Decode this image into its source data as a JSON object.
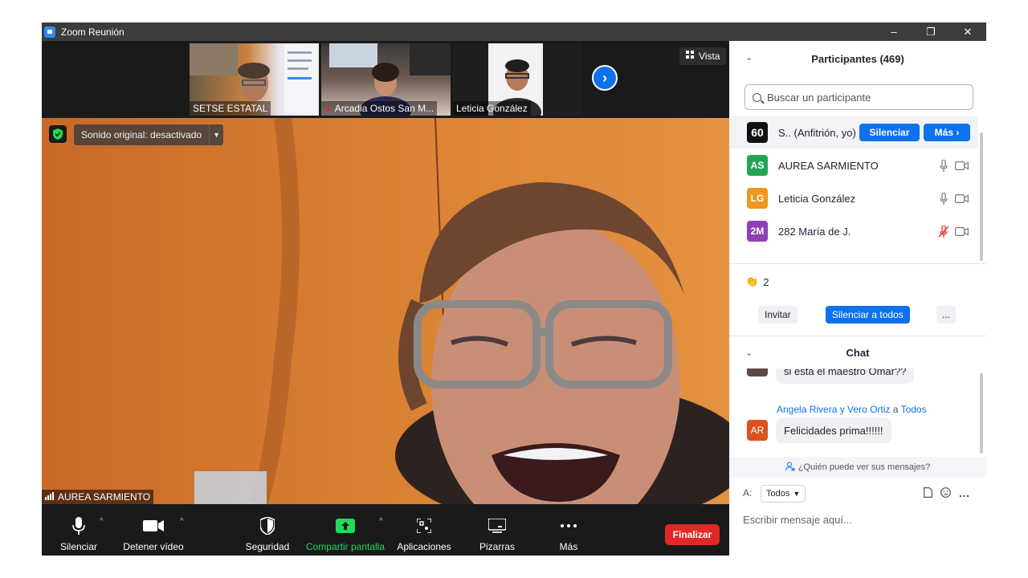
{
  "window": {
    "title": "Zoom Reunión",
    "minimize": "–",
    "restore": "❐",
    "close": "✕"
  },
  "thumbnails": [
    {
      "name": "SETSE ESTATAL"
    },
    {
      "name": "Arcadia Ostos San M..."
    },
    {
      "name": "Leticia González"
    }
  ],
  "view_button": "Vista",
  "sound_label": "Sonido original: desactivado",
  "main_speaker": "AUREA SARMIENTO",
  "toolbar": {
    "mute": "Silenciar",
    "stop_video": "Detener vídeo",
    "security": "Seguridad",
    "share_screen": "Compartir pantalla",
    "apps": "Aplicaciones",
    "whiteboards": "Pizarras",
    "more": "Más",
    "end": "Finalizar"
  },
  "participants": {
    "title": "Participantes (469)",
    "search_placeholder": "Buscar un participante",
    "list": [
      {
        "initials": "60",
        "name": "S.. (Anfitrión, yo)",
        "color": "#000000"
      },
      {
        "initials": "AS",
        "name": "AUREA SARMIENTO",
        "color": "#23a455"
      },
      {
        "initials": "LG",
        "name": "Leticia González",
        "color": "#f0961e"
      },
      {
        "initials": "2M",
        "name": "282 María de J.",
        "color": "#8e3fb8"
      }
    ],
    "host_mute": "Silenciar",
    "host_more": "Más",
    "reaction_count": "2",
    "invite": "Invitar",
    "mute_all": "Silenciar a todos",
    "more_options": "..."
  },
  "chat": {
    "title": "Chat",
    "messages": [
      {
        "text": "si esta el maestro Omar??"
      },
      {
        "sender": "Angela Rivera y Vero Ortiz",
        "to_word": "a",
        "to": "Todos",
        "avatar": "AR",
        "text": "Felicidades prima!!!!!!"
      }
    ],
    "who_can_see": "¿Quién puede ver sus mensajes?",
    "to_label": "A:",
    "recipient": "Todos",
    "input_placeholder": "Escribir mensaje aquí..."
  },
  "colors": {
    "accent": "#0e72ed",
    "end_red": "#e02828",
    "share_green": "#23d959"
  }
}
